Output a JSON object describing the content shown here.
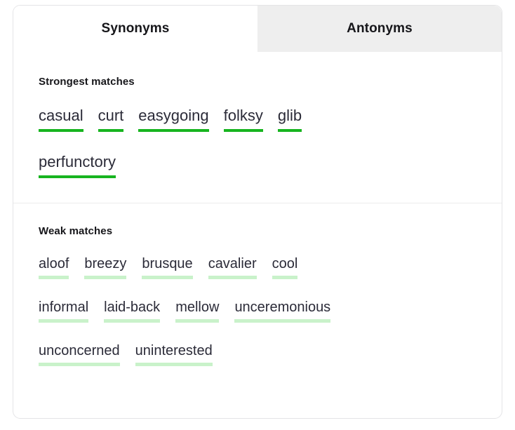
{
  "tabs": [
    {
      "label": "Synonyms",
      "active": true
    },
    {
      "label": "Antonyms",
      "active": false
    }
  ],
  "sections": [
    {
      "heading": "Strongest matches",
      "match_strength": "strong",
      "underline_color": "#17b41f",
      "rows": [
        [
          "casual",
          "curt",
          "easygoing",
          "folksy",
          "glib"
        ],
        [
          "perfunctory"
        ]
      ]
    },
    {
      "heading": "Weak matches",
      "match_strength": "weak",
      "underline_color": "#c9f2ca",
      "rows": [
        [
          "aloof",
          "breezy",
          "brusque",
          "cavalier",
          "cool"
        ],
        [
          "informal",
          "laid-back",
          "mellow",
          "unceremonious"
        ],
        [
          "unconcerned",
          "uninterested"
        ]
      ]
    }
  ],
  "colors": {
    "card_border": "#e4e4e6",
    "active_tab_bg": "#ffffff",
    "inactive_tab_bg": "#eeeeee",
    "word_text": "#2b2b38",
    "heading_text": "#16161a",
    "divider": "#ececec"
  }
}
